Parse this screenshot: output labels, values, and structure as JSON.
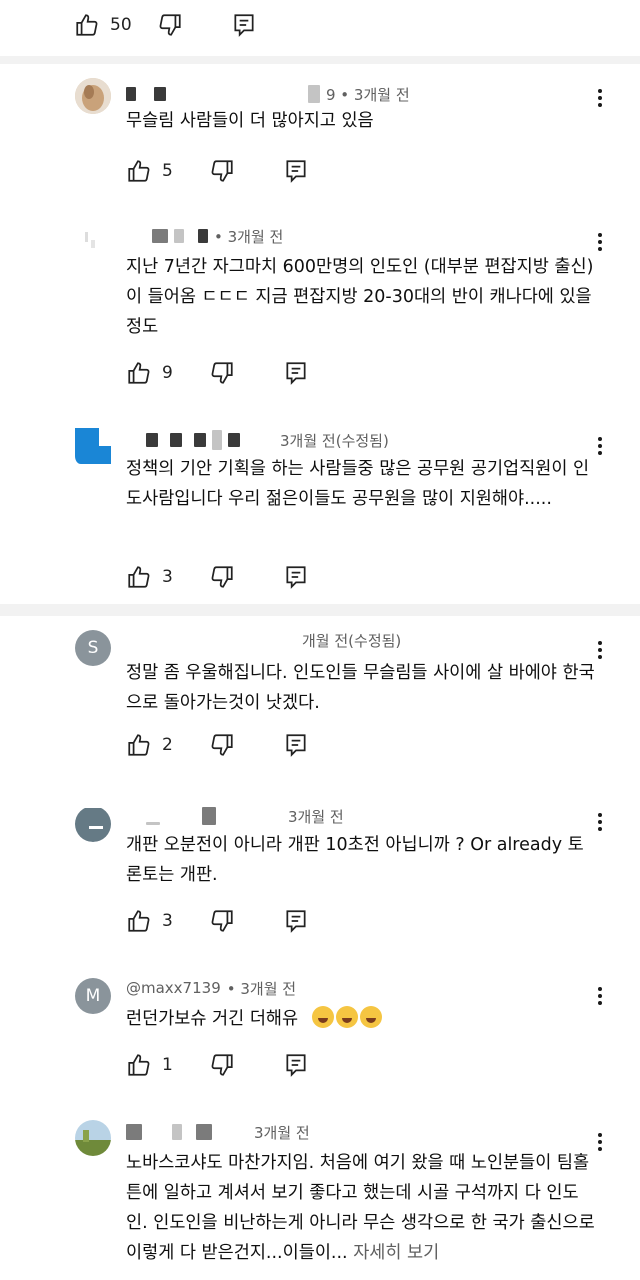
{
  "top_bar": {
    "likes": "50"
  },
  "comments": [
    {
      "id": "c1",
      "time": "9 • 3개월 전",
      "text": "무슬림 사람들이 더 많아지고 있음",
      "likes": "5"
    },
    {
      "id": "c2",
      "time": "• 3개월 전",
      "text": "지난 7년간 자그마치 600만명의 인도인 (대부분 편잡지방 출신)이 들어옴 ㄷㄷㄷ 지금 편잡지방 20-30대의 반이 캐나다에 있을정도",
      "likes": "9"
    },
    {
      "id": "c3",
      "time": "3개월 전(수정됨)",
      "text": "정책의 기안 기획을 하는 사람들중 많은 공무원 공기업직원이 인도사람입니다 우리 젊은이들도 공무원을 많이 지원해야.....",
      "likes": "3"
    },
    {
      "id": "c4",
      "avatar_letter": "S",
      "time": "개월 전(수정됨)",
      "text": "정말 좀 우울해집니다. 인도인들 무슬림들 사이에 살 바에야 한국으로 돌아가는것이 낫겠다.",
      "likes": "2"
    },
    {
      "id": "c5",
      "time": "3개월 전",
      "text": "개판 오분전이 아니라 개판 10초전 아닙니까 ? Or already 토론토는 개판.",
      "likes": "3"
    },
    {
      "id": "c6",
      "avatar_letter": "M",
      "author": "@maxx7139",
      "time": "• 3개월 전",
      "text": "런던가보슈 거긴 더해유",
      "likes": "1"
    },
    {
      "id": "c7",
      "time": "3개월 전",
      "text": "노바스코샤도 마찬가지임. 처음에 여기 왔을 때 노인분들이 팀홀튼에 일하고 계셔서 보기 좋다고 했는데 시골 구석까지 다 인도인. 인도인을 비난하는게 아니라 무슨 생각으로 한 국가 출신으로 이렇게 다 받은건지...이들이...",
      "read_more": "자세히 보기"
    }
  ],
  "colors": {
    "avatar_s": "#8a949b",
    "avatar_m": "#8a949b",
    "avatar_blue": "#1a86d6",
    "separator": "#f2f2f2"
  }
}
